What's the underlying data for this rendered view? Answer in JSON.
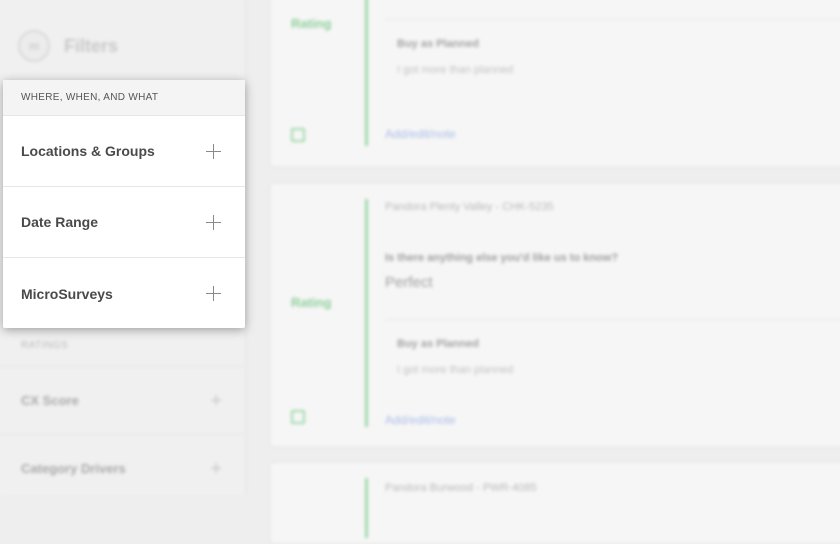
{
  "sidebar": {
    "logo_text": "m",
    "title": "Filters",
    "ratings_section": "RATINGS",
    "items": [
      {
        "label": "CX Score",
        "icon": "plus-icon"
      },
      {
        "label": "Category Drivers",
        "icon": "plus-icon"
      }
    ]
  },
  "dropdown": {
    "header": "WHERE, WHEN, AND WHAT",
    "items": [
      {
        "label": "Locations & Groups",
        "icon": "plus-icon"
      },
      {
        "label": "Date Range",
        "icon": "plus-icon"
      },
      {
        "label": "MicroSurveys",
        "icon": "plus-icon"
      }
    ]
  },
  "feed": {
    "cards": [
      {
        "rating_label": "Rating",
        "inner_title": "Buy as Planned",
        "inner_subtitle": "I got more than planned",
        "link": "Add/edit/note"
      },
      {
        "location": "Pandora Plenty Valley - CHK-5235",
        "question": "Is there anything else you'd like us to know?",
        "answer": "Perfect",
        "rating_label": "Rating",
        "inner_title": "Buy as Planned",
        "inner_subtitle": "I got more than planned",
        "link": "Add/edit/note"
      },
      {
        "location": "Pandora Burwood - PWR-4085"
      }
    ]
  },
  "colors": {
    "accent_green": "#9fd9ab",
    "link_blue": "#a9bce6",
    "panel_bg": "#ffffff"
  }
}
